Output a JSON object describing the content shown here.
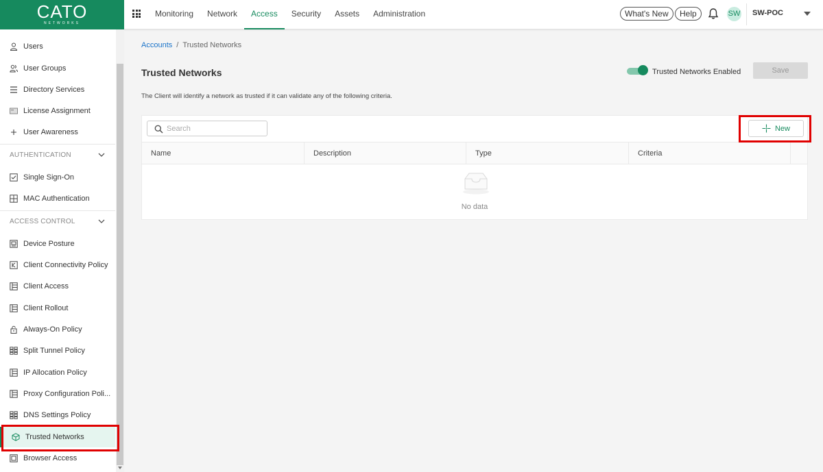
{
  "brand": {
    "name": "CATO",
    "subtitle": "NETWORKS",
    "color": "#168a5e"
  },
  "nav": {
    "items": [
      {
        "label": "Monitoring",
        "active": false
      },
      {
        "label": "Network",
        "active": false
      },
      {
        "label": "Access",
        "active": true
      },
      {
        "label": "Security",
        "active": false
      },
      {
        "label": "Assets",
        "active": false
      },
      {
        "label": "Administration",
        "active": false
      }
    ]
  },
  "header": {
    "whats_new": "What's New",
    "help": "Help",
    "avatar_initials": "SW",
    "account": "SW-POC"
  },
  "sidebar": {
    "items": [
      {
        "label": "Users",
        "icon": "user-icon"
      },
      {
        "label": "User Groups",
        "icon": "user-group-icon"
      },
      {
        "label": "Directory Services",
        "icon": "directory-icon"
      },
      {
        "label": "License Assignment",
        "icon": "license-icon"
      },
      {
        "label": "User Awareness",
        "icon": "plus-icon"
      }
    ],
    "section_auth": "AUTHENTICATION",
    "auth_items": [
      {
        "label": "Single Sign-On",
        "icon": "checkbox-icon"
      },
      {
        "label": "MAC Authentication",
        "icon": "grid-icon"
      }
    ],
    "section_access": "ACCESS CONTROL",
    "access_items": [
      {
        "label": "Device Posture",
        "icon": "device-icon"
      },
      {
        "label": "Client Connectivity Policy",
        "icon": "policy-icon"
      },
      {
        "label": "Client Access",
        "icon": "table-icon"
      },
      {
        "label": "Client Rollout",
        "icon": "table-icon"
      },
      {
        "label": "Always-On Policy",
        "icon": "lock-icon"
      },
      {
        "label": "Split Tunnel Policy",
        "icon": "split-icon"
      },
      {
        "label": "IP Allocation Policy",
        "icon": "table-icon"
      },
      {
        "label": "Proxy Configuration Poli...",
        "icon": "table-icon"
      },
      {
        "label": "DNS Settings Policy",
        "icon": "split-icon"
      },
      {
        "label": "Trusted Networks",
        "icon": "cube-icon",
        "active": true
      },
      {
        "label": "Browser Access",
        "icon": "window-icon"
      }
    ]
  },
  "breadcrumb": {
    "parent": "Accounts",
    "separator": "/",
    "current": "Trusted Networks"
  },
  "page": {
    "title": "Trusted Networks",
    "toggle_label": "Trusted Networks Enabled",
    "toggle_on": true,
    "save_label": "Save",
    "description": "The Client will identify a network as trusted if it can validate any of the following criteria."
  },
  "search": {
    "placeholder": "Search",
    "value": ""
  },
  "new_button": {
    "label": "New"
  },
  "table": {
    "columns": [
      "Name",
      "Description",
      "Type",
      "Criteria"
    ],
    "rows": [],
    "empty_text": "No data"
  }
}
